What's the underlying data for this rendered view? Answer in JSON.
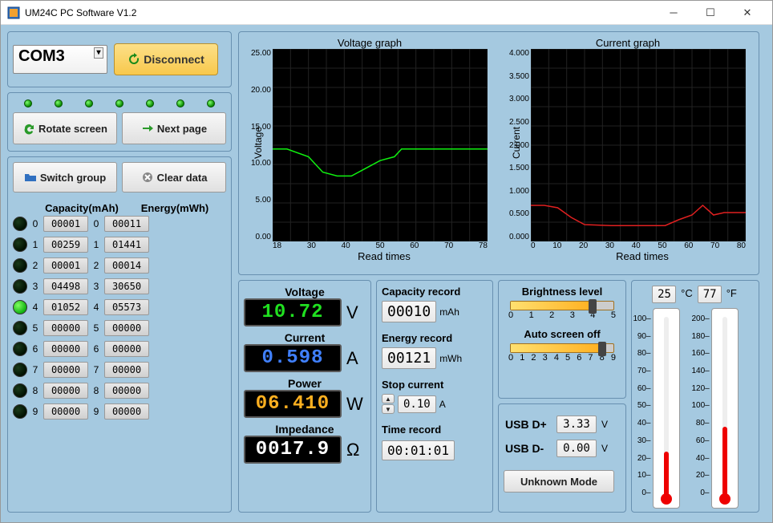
{
  "window": {
    "title": "UM24C PC Software V1.2"
  },
  "conn": {
    "port": "COM3",
    "disconnect": "Disconnect",
    "rotate": "Rotate screen",
    "next": "Next page"
  },
  "datagrp": {
    "switch": "Switch group",
    "clear": "Clear data",
    "cap_header": "Capacity(mAh)",
    "eng_header": "Energy(mWh)",
    "rows": [
      {
        "i": "0",
        "cap": "00001",
        "eng": "00011",
        "on": false
      },
      {
        "i": "1",
        "cap": "00259",
        "eng": "01441",
        "on": false
      },
      {
        "i": "2",
        "cap": "00001",
        "eng": "00014",
        "on": false
      },
      {
        "i": "3",
        "cap": "04498",
        "eng": "30650",
        "on": false
      },
      {
        "i": "4",
        "cap": "01052",
        "eng": "05573",
        "on": true
      },
      {
        "i": "5",
        "cap": "00000",
        "eng": "00000",
        "on": false
      },
      {
        "i": "6",
        "cap": "00000",
        "eng": "00000",
        "on": false
      },
      {
        "i": "7",
        "cap": "00000",
        "eng": "00000",
        "on": false
      },
      {
        "i": "8",
        "cap": "00000",
        "eng": "00000",
        "on": false
      },
      {
        "i": "9",
        "cap": "00000",
        "eng": "00000",
        "on": false
      }
    ]
  },
  "charts": {
    "voltage": {
      "title": "Voltage graph",
      "ylabel": "Voltage",
      "xlabel": "Read times"
    },
    "current": {
      "title": "Current graph",
      "ylabel": "Current",
      "xlabel": "Read times"
    }
  },
  "chart_data": [
    {
      "type": "line",
      "title": "Voltage graph",
      "xlabel": "Read times",
      "ylabel": "Voltage",
      "ylim": [
        0,
        25
      ],
      "xlim": [
        18,
        78
      ],
      "yticks": [
        "0.00",
        "5.00",
        "10.00",
        "15.00",
        "20.00",
        "25.00"
      ],
      "xticks": [
        "18",
        "30",
        "40",
        "50",
        "60",
        "70",
        "78"
      ],
      "x": [
        18,
        22,
        28,
        32,
        36,
        40,
        44,
        48,
        52,
        54,
        60,
        66,
        72,
        78
      ],
      "values": [
        12.0,
        12.0,
        11.0,
        9.0,
        8.5,
        8.5,
        9.5,
        10.5,
        11.0,
        12.0,
        12.0,
        12.0,
        12.0,
        12.0
      ],
      "color": "#10f010"
    },
    {
      "type": "line",
      "title": "Current graph",
      "xlabel": "Read times",
      "ylabel": "Current",
      "ylim": [
        0,
        4
      ],
      "xlim": [
        0,
        80
      ],
      "yticks": [
        "0.000",
        "0.500",
        "1.000",
        "1.500",
        "2.000",
        "2.500",
        "3.000",
        "3.500",
        "4.000"
      ],
      "xticks": [
        "0",
        "10",
        "20",
        "30",
        "40",
        "50",
        "60",
        "70",
        "80"
      ],
      "x": [
        0,
        5,
        10,
        15,
        20,
        30,
        40,
        50,
        55,
        60,
        64,
        68,
        72,
        76,
        80
      ],
      "values": [
        0.75,
        0.75,
        0.7,
        0.5,
        0.35,
        0.33,
        0.33,
        0.33,
        0.45,
        0.55,
        0.75,
        0.55,
        0.6,
        0.6,
        0.6
      ],
      "color": "#e02020"
    }
  ],
  "readings": {
    "voltage_lbl": "Voltage",
    "voltage": "10.72",
    "voltage_u": "V",
    "current_lbl": "Current",
    "current": "0.598",
    "current_u": "A",
    "power_lbl": "Power",
    "power": "06.410",
    "power_u": "W",
    "imped_lbl": "Impedance",
    "imped": "0017.9",
    "imped_u": "Ω"
  },
  "record": {
    "cap_lbl": "Capacity record",
    "cap": "00010",
    "cap_u": "mAh",
    "eng_lbl": "Energy record",
    "eng": "00121",
    "eng_u": "mWh",
    "stop_lbl": "Stop current",
    "stop": "0.10",
    "stop_u": "A",
    "time_lbl": "Time record",
    "time": "00:01:01"
  },
  "settings": {
    "bright_lbl": "Brightness level",
    "bright_val": 4,
    "bright_max": 5,
    "bright_ticks": [
      "0",
      "1",
      "2",
      "3",
      "4",
      "5"
    ],
    "auto_lbl": "Auto screen off",
    "auto_val": 8,
    "auto_max": 9,
    "auto_ticks": [
      "0",
      "1",
      "2",
      "3",
      "4",
      "5",
      "6",
      "7",
      "8",
      "9"
    ]
  },
  "usb": {
    "dplus_lbl": "USB D+",
    "dplus": "3.33",
    "dplus_u": "V",
    "dminus_lbl": "USB D-",
    "dminus": "0.00",
    "dminus_u": "V",
    "mode": "Unknown Mode"
  },
  "temp": {
    "c": "25",
    "c_u": "°C",
    "f": "77",
    "f_u": "°F",
    "c_ticks": [
      "100",
      "90",
      "80",
      "70",
      "60",
      "50",
      "40",
      "30",
      "20",
      "10",
      "0"
    ],
    "f_ticks": [
      "200",
      "180",
      "160",
      "140",
      "120",
      "100",
      "80",
      "60",
      "40",
      "20",
      "0"
    ],
    "c_frac": 0.25,
    "f_frac": 0.385
  }
}
